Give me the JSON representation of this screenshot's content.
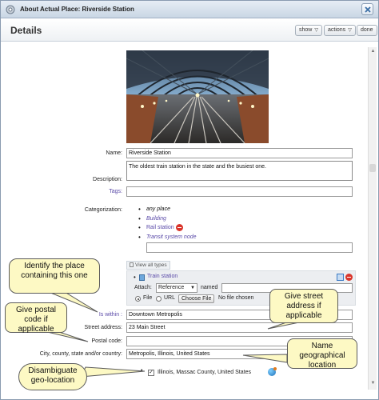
{
  "window": {
    "title": "About Actual Place: Riverside Station"
  },
  "header": {
    "title": "Details",
    "show_label": "show",
    "actions_label": "actions",
    "done_label": "done"
  },
  "form": {
    "name_label": "Name:",
    "name_value": "Riverside Station",
    "description_label": "Description:",
    "description_value": "The oldest train station in the state and the busiest one.",
    "tags_label": "Tags:",
    "categorization_label": "Categorization:",
    "categories": [
      {
        "label": "any place",
        "style": "plain"
      },
      {
        "label": "Building",
        "style": "link"
      },
      {
        "label": "Rail station",
        "style": "link",
        "removable": true
      },
      {
        "label": "Transit system node",
        "style": "link"
      }
    ],
    "view_all_types_label": "View all types",
    "type_panel": {
      "item_label": "Train station",
      "attach_label": "Attach:",
      "attach_select_value": "Reference",
      "named_label": "named",
      "file_option": "File",
      "url_option": "URL",
      "choose_file_label": "Choose File",
      "no_file_text": "No file chosen"
    },
    "is_within_label": "Is within :",
    "is_within_value": "Downtown Metropolis",
    "street_label": "Street address:",
    "street_value": "23 Main Street",
    "postal_label": "Postal code:",
    "postal_value": "",
    "city_label": "City, county, state and/or country:",
    "city_value": "Metropolis, Illinois, United States",
    "geo_match": "Illinois, Massac County, United States"
  },
  "callouts": {
    "identify": "Identify the place containing this one",
    "postal": "Give postal code if applicable",
    "street": "Give street address if applicable",
    "name_geo": "Name geographical location",
    "disambiguate": "Disambiguate geo-location"
  },
  "colors": {
    "link": "#5a4aa8",
    "callout_bg": "#fdf9c4",
    "remove": "#d9352b"
  },
  "icons": [
    "settings-icon",
    "close-icon",
    "remove-icon",
    "document-icon",
    "copy-icon",
    "globe-icon"
  ]
}
